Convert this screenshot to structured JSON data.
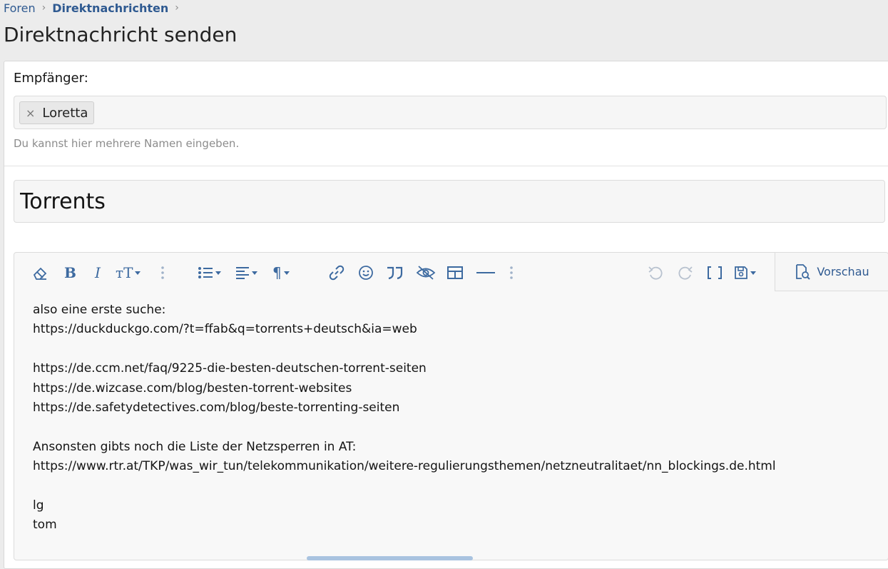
{
  "breadcrumb": {
    "items": [
      {
        "label": "Foren",
        "bold": false
      },
      {
        "label": "Direktnachrichten",
        "bold": true
      }
    ],
    "separator": "›"
  },
  "page_title": "Direktnachricht senden",
  "recipients": {
    "label": "Empfänger:",
    "tokens": [
      "Loretta"
    ],
    "remove_glyph": "×",
    "hint": "Du kannst hier mehrere Namen eingeben."
  },
  "title_field": {
    "value": "Torrents"
  },
  "toolbar": {
    "buttons": [
      {
        "name": "eraser-icon"
      },
      {
        "name": "bold-icon",
        "glyph": "B"
      },
      {
        "name": "italic-icon",
        "glyph": "I"
      },
      {
        "name": "text-size-icon",
        "glyph": "тT"
      },
      {
        "name": "more-options-icon"
      },
      {
        "name": "list-icon"
      },
      {
        "name": "align-icon"
      },
      {
        "name": "paragraph-icon",
        "glyph": "¶"
      },
      {
        "name": "link-icon"
      },
      {
        "name": "smiley-icon"
      },
      {
        "name": "quote-icon",
        "glyph": "❞"
      },
      {
        "name": "spoiler-icon"
      },
      {
        "name": "table-icon"
      },
      {
        "name": "horizontal-line-icon"
      },
      {
        "name": "more-insert-icon"
      },
      {
        "name": "undo-icon"
      },
      {
        "name": "redo-icon"
      },
      {
        "name": "bbcode-toggle-icon",
        "glyph": "[ ]"
      },
      {
        "name": "drafts-icon"
      }
    ],
    "preview_label": "Vorschau",
    "accent": "#3d6aa0"
  },
  "message_lines": [
    "also eine erste suche:",
    "https://duckduckgo.com/?t=ffab&q=torrents+deutsch&ia=web",
    "",
    "https://de.ccm.net/faq/9225-die-besten-deutschen-torrent-seiten",
    "https://de.wizcase.com/blog/besten-torrent-websites",
    "https://de.safetydetectives.com/blog/beste-torrenting-seiten",
    "",
    "Ansonsten gibts noch die Liste der Netzsperren in AT:",
    "https://www.rtr.at/TKP/was_wir_tun/telekommunikation/weitere-regulierungsthemen/netzneutralitaet/nn_blockings.de.html",
    "",
    "lg",
    "tom"
  ]
}
